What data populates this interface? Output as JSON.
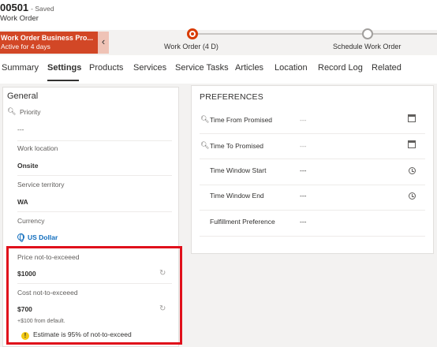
{
  "record": {
    "id": "00501",
    "saved_status": "- Saved",
    "entity": "Work Order"
  },
  "bpf": {
    "active_title": "Work Order Business Pro...",
    "active_subtitle": "Active for 4 days",
    "collapse_glyph": "‹",
    "stages": [
      {
        "label": "Work Order  (4 D)",
        "state": "active"
      },
      {
        "label": "Schedule Work Order",
        "state": "next"
      }
    ],
    "accent_color": "#d24726"
  },
  "tabs": [
    {
      "label": "Summary"
    },
    {
      "label": "Settings",
      "selected": true
    },
    {
      "label": "Products"
    },
    {
      "label": "Services"
    },
    {
      "label": "Service Tasks"
    },
    {
      "label": "Articles"
    },
    {
      "label": "Location"
    },
    {
      "label": "Record Log"
    },
    {
      "label": "Related"
    }
  ],
  "general": {
    "title": "General",
    "priority": {
      "label": "Priority",
      "value": "---"
    },
    "work_location": {
      "label": "Work location",
      "value": "Onsite"
    },
    "service_territory": {
      "label": "Service territory",
      "value": "WA"
    },
    "currency": {
      "label": "Currency",
      "value": "US Dollar"
    },
    "price_nte": {
      "label": "Price not-to-exceeed",
      "value": "$1000"
    },
    "cost_nte": {
      "label": "Cost not-to-exceeed",
      "value": "$700",
      "note": "+$100 from default."
    },
    "warning": "Estimate is 95% of not-to-exceed"
  },
  "preferences": {
    "title": "PREFERENCES",
    "rows": [
      {
        "label": "Time From Promised",
        "value": "---",
        "icon": "calendar-icon",
        "locked": true
      },
      {
        "label": "Time To Promised",
        "value": "---",
        "icon": "calendar-icon",
        "locked": true
      },
      {
        "label": "Time Window Start",
        "value": "---",
        "icon": "clock-icon"
      },
      {
        "label": "Time Window End",
        "value": "---",
        "icon": "clock-icon"
      },
      {
        "label": "Fulfillment Preference",
        "value": "---"
      }
    ]
  },
  "highlight_color": "#e0101b"
}
